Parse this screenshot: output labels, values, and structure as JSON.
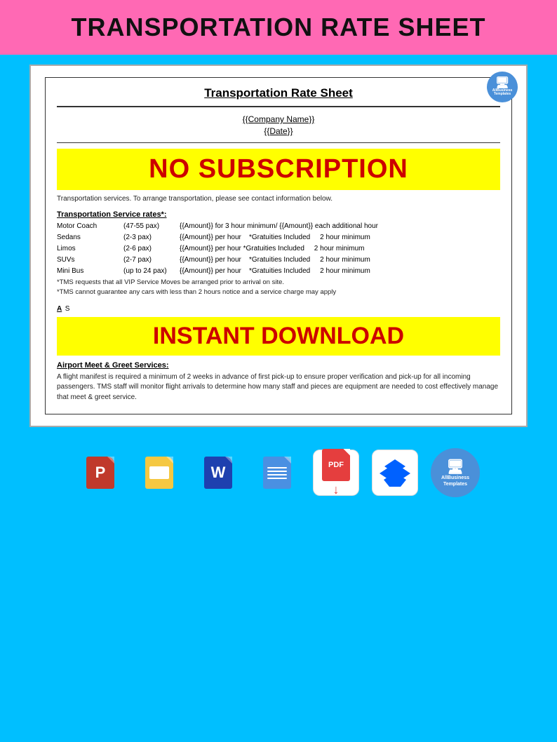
{
  "header": {
    "title": "TRANSPORTATION RATE SHEET",
    "bg_color": "#ff69b4"
  },
  "document": {
    "title": "Transportation Rate Sheet",
    "company_placeholder": "{{Company Name}}",
    "date_placeholder": "{{Date}}",
    "overlay1": "NO SUBSCRIPTION",
    "overlay2": "INSTANT DOWNLOAD",
    "intro": "Transportation services. To arrange transportation, please see contact information below.",
    "services_heading": "Transportation Service rates*:",
    "rates": [
      {
        "name": "Motor Coach",
        "pax": "(47-55 pax)",
        "rate": "{{Amount}} for 3 hour minimum/ {{Amount}} each additional hour"
      },
      {
        "name": "Sedans",
        "pax": "(2-3 pax)",
        "rate": "{{Amount}} per hour    *Gratuities Included    2 hour minimum"
      },
      {
        "name": "Limos",
        "pax": "(2-6 pax)",
        "rate": "{{Amount}} per hour *Gratuities Included    2 hour minimum"
      },
      {
        "name": "SUVs",
        "pax": "(2-7 pax)",
        "rate": "{{Amount}} per hour    *Gratuities Included    2 hour minimum"
      },
      {
        "name": "Mini Bus",
        "pax": "(up to 24 pax)",
        "rate": "{{Amount}} per hour    *Gratuities Included    2 hour minimum"
      }
    ],
    "footnotes": [
      "*TMS requests that all VIP Service Moves be arranged prior to arrival on site.",
      "*TMS cannot guarantee any cars with less than 2 hours notice and a service charge may apply"
    ],
    "airport_heading": "Airport Meet & Greet Services:",
    "airport_text": "A flight manifest is required a minimum of 2 weeks in advance of first pick-up to ensure proper verification and pick-up for all incoming passengers. TMS staff will monitor flight arrivals to determine how many staff and pieces are equipment are needed to cost effectively manage that meet & greet service."
  },
  "toolbar": {
    "icons": [
      {
        "id": "powerpoint",
        "label": "P",
        "title": "PowerPoint"
      },
      {
        "id": "gslides",
        "label": "G Slides",
        "title": "Google Slides"
      },
      {
        "id": "word",
        "label": "W",
        "title": "Microsoft Word"
      },
      {
        "id": "gdocs",
        "label": "G Docs",
        "title": "Google Docs"
      },
      {
        "id": "pdf",
        "label": "PDF",
        "title": "PDF"
      },
      {
        "id": "dropbox",
        "label": "Dropbox",
        "title": "Dropbox"
      },
      {
        "id": "allbiz",
        "label": "AllBusiness Templates",
        "title": "AllBusiness Templates"
      }
    ]
  },
  "allbiz": {
    "name": "AllBusiness",
    "tagline": "Templates"
  }
}
